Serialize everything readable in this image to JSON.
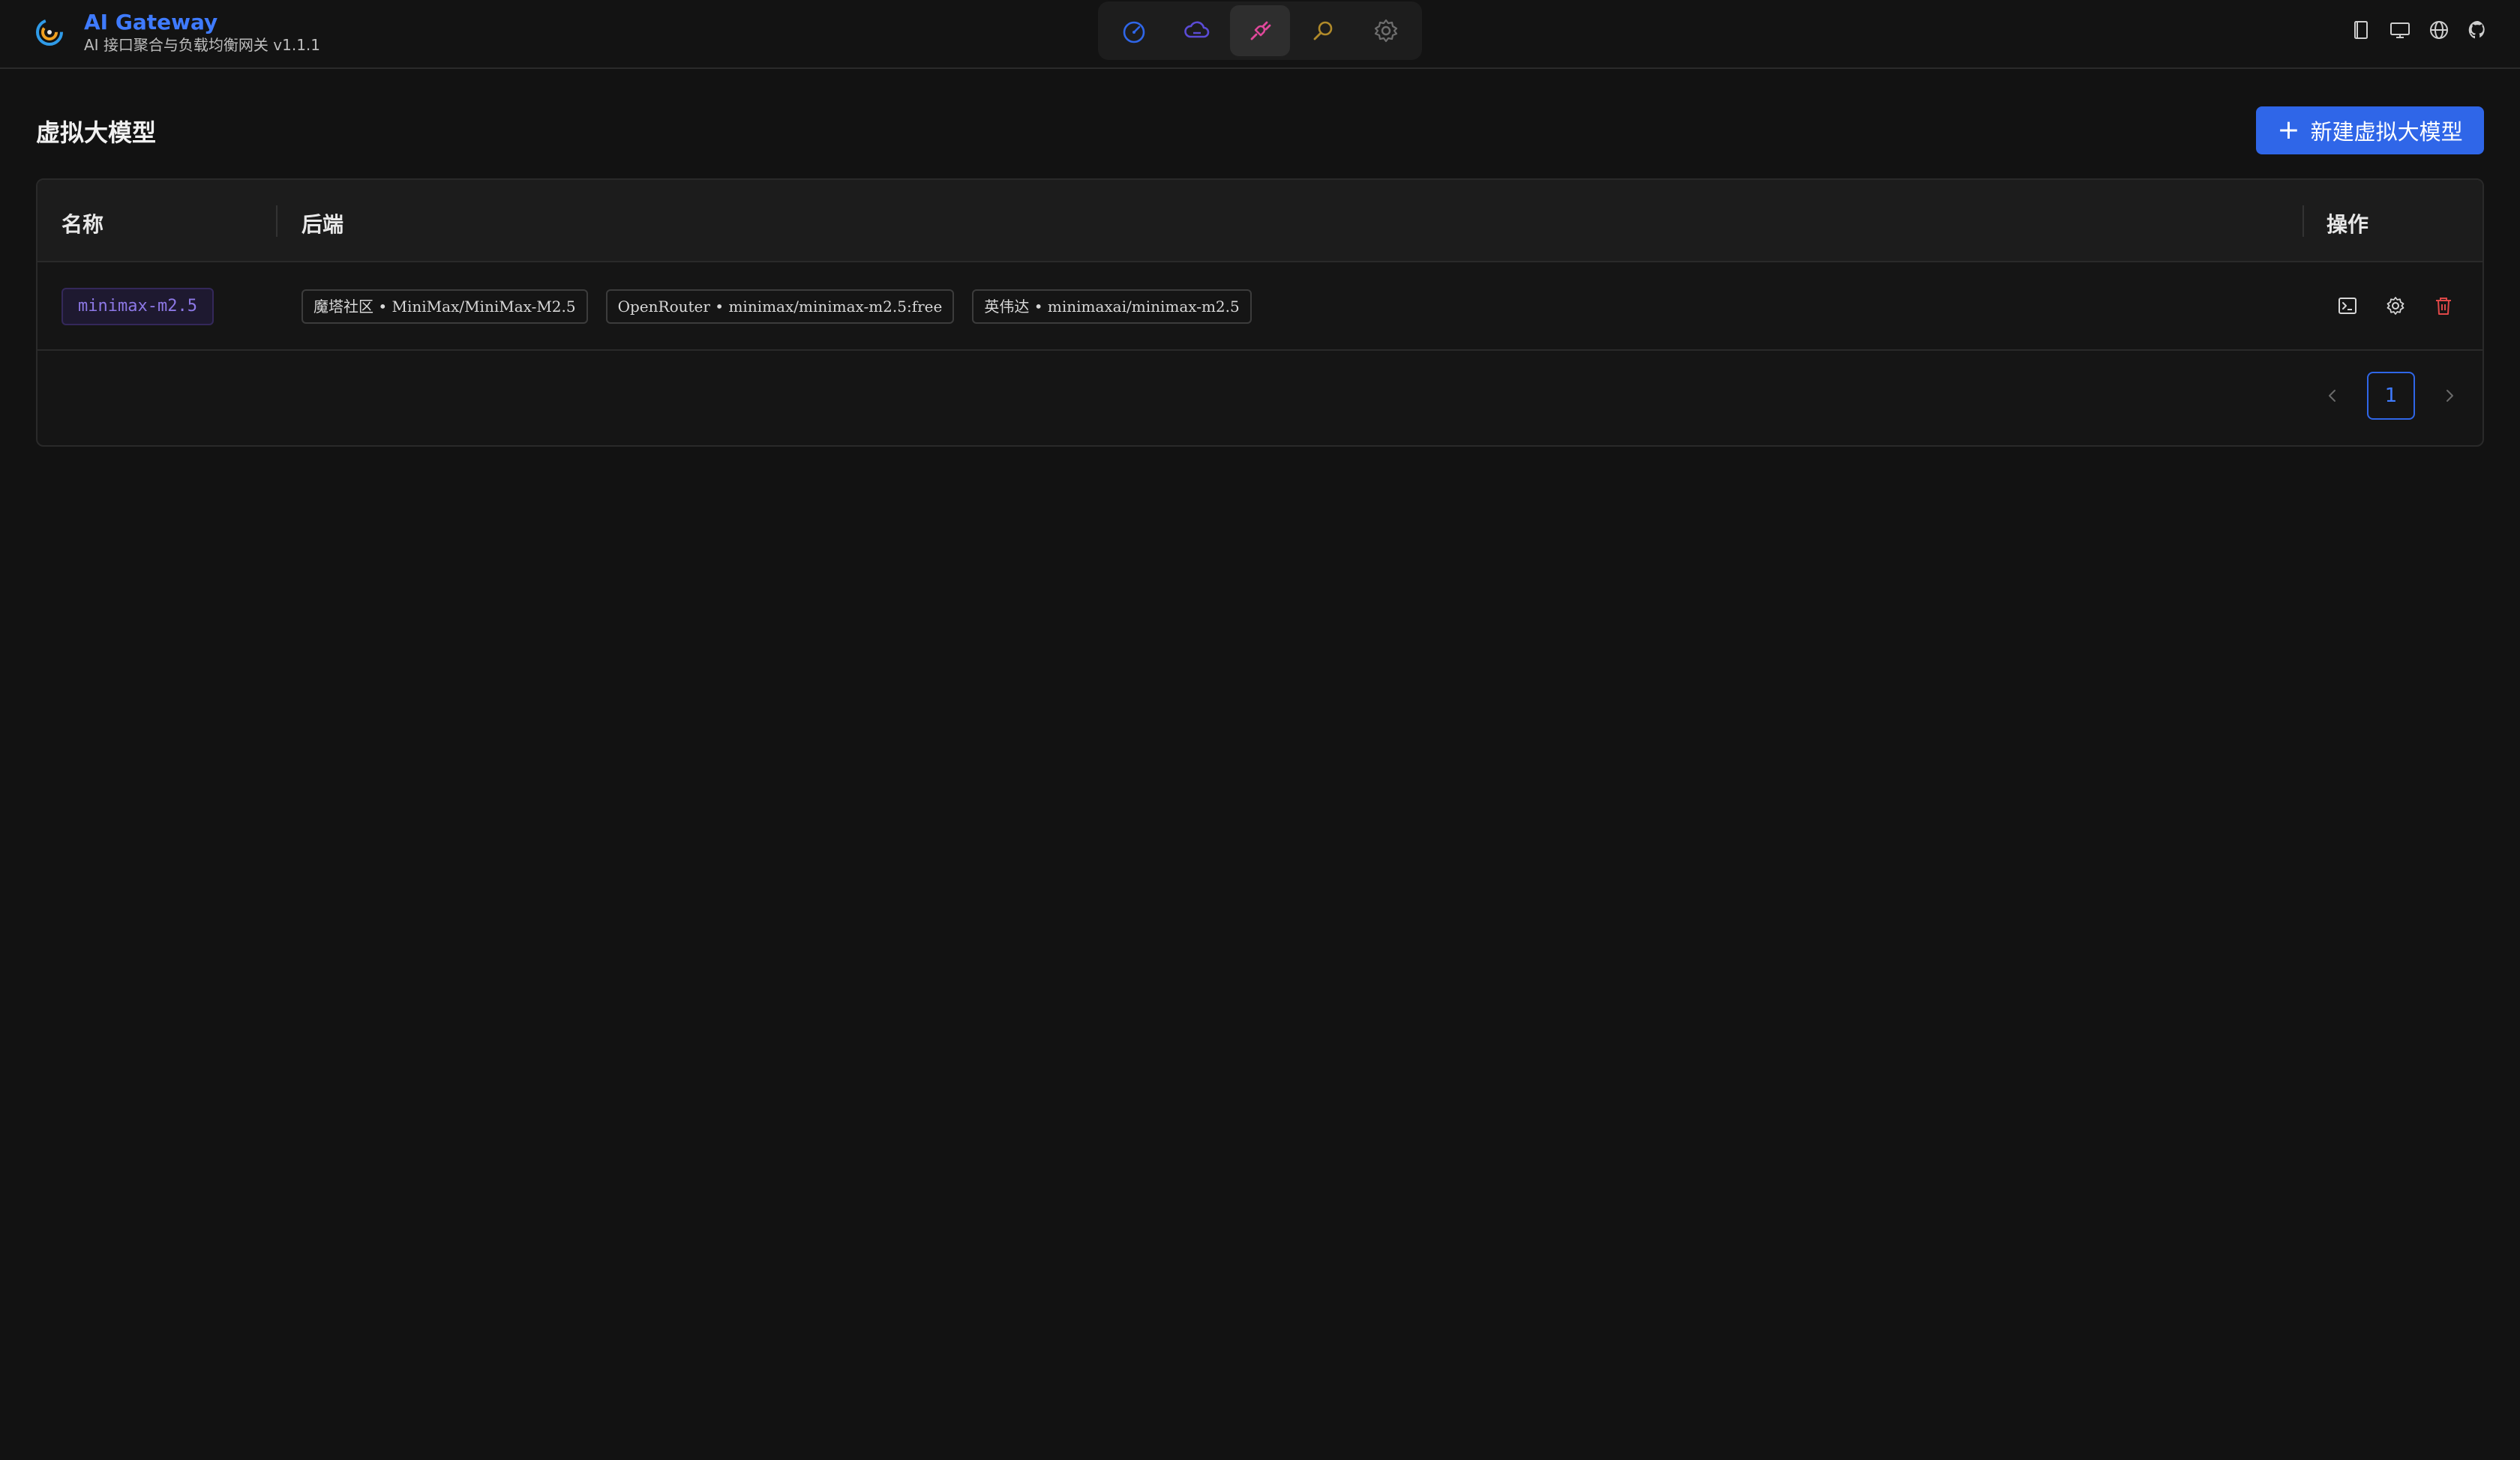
{
  "app": {
    "title": "AI Gateway",
    "subtitle": "AI 接口聚合与负载均衡网关 v1.1.1"
  },
  "nav": {
    "items": [
      {
        "icon": "dashboard-gauge-icon",
        "color": "#2f66e8"
      },
      {
        "icon": "cloud-icon",
        "color": "#5b4bd6"
      },
      {
        "icon": "plug-icon",
        "color": "#e0489b",
        "active": true
      },
      {
        "icon": "search-icon",
        "color": "#b08a2a"
      },
      {
        "icon": "gear-icon",
        "color": "#6e6e6e"
      }
    ]
  },
  "header_tools": [
    "book-icon",
    "monitor-icon",
    "globe-icon",
    "github-icon"
  ],
  "page": {
    "title": "虚拟大模型",
    "add_button": "新建虚拟大模型"
  },
  "table": {
    "columns": {
      "name": "名称",
      "backend": "后端",
      "actions": "操作"
    },
    "rows": [
      {
        "name": "minimax-m2.5",
        "backends": [
          "魔塔社区 • MiniMax/MiniMax-M2.5",
          "OpenRouter • minimax/minimax-m2.5:free",
          "英伟达 • minimaxai/minimax-m2.5"
        ]
      }
    ]
  },
  "pagination": {
    "current_page": "1"
  },
  "colors": {
    "accent": "#2f66e8",
    "delete": "#e04848",
    "name_tag": "#8d78e6"
  }
}
